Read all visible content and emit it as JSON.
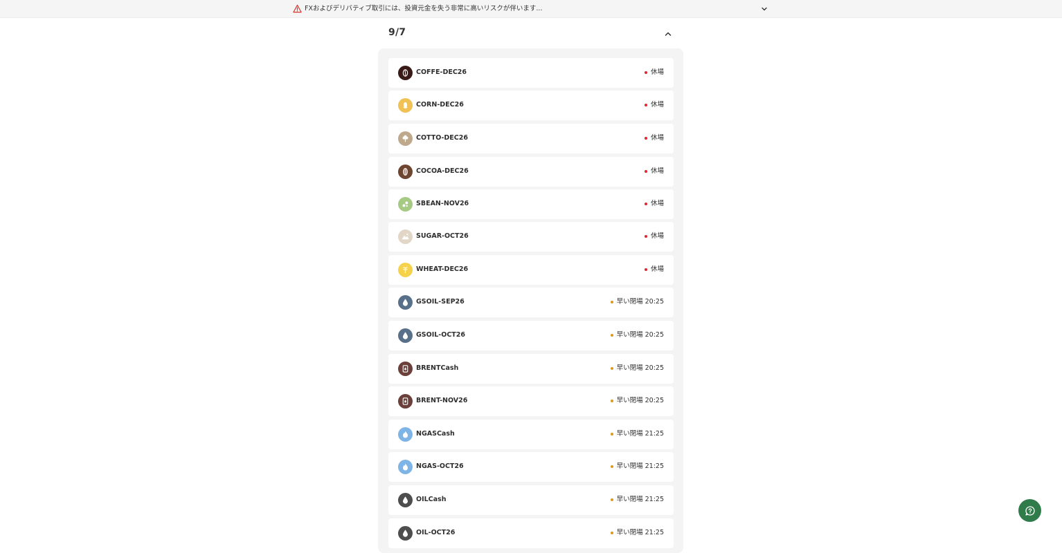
{
  "banner": {
    "text": "FXおよびデリバティブ取引には、投資元金を失う非常に高いリスクが伴います...",
    "warning_color": "#d9342b"
  },
  "section": {
    "date": "9/7"
  },
  "instruments": [
    {
      "name": "COFFE-DEC26",
      "status": "休場",
      "status_kind": "closed",
      "icon": "coffee-bean-icon",
      "icon_color": "#3a1a17"
    },
    {
      "name": "CORN-DEC26",
      "status": "休場",
      "status_kind": "closed",
      "icon": "corn-icon",
      "icon_color": "#f0c154"
    },
    {
      "name": "COTTO-DEC26",
      "status": "休場",
      "status_kind": "closed",
      "icon": "cotton-icon",
      "icon_color": "#bfa98d"
    },
    {
      "name": "COCOA-DEC26",
      "status": "休場",
      "status_kind": "closed",
      "icon": "cocoa-pod-icon",
      "icon_color": "#6e4630"
    },
    {
      "name": "SBEAN-NOV26",
      "status": "休場",
      "status_kind": "closed",
      "icon": "soybean-icon",
      "icon_color": "#a6c983"
    },
    {
      "name": "SUGAR-OCT26",
      "status": "休場",
      "status_kind": "closed",
      "icon": "sugar-icon",
      "icon_color": "#e2d6c6"
    },
    {
      "name": "WHEAT-DEC26",
      "status": "休場",
      "status_kind": "closed",
      "icon": "wheat-icon",
      "icon_color": "#f6d24a"
    },
    {
      "name": "GSOIL-SEP26",
      "status": "早い閉場 20:25",
      "status_kind": "early",
      "icon": "oil-drop-icon",
      "icon_color": "#587089"
    },
    {
      "name": "GSOIL-OCT26",
      "status": "早い閉場 20:25",
      "status_kind": "early",
      "icon": "oil-drop-icon",
      "icon_color": "#587089"
    },
    {
      "name": "BRENTCash",
      "status": "早い閉場 20:25",
      "status_kind": "early",
      "icon": "oil-barrel-icon",
      "icon_color": "#6b403a"
    },
    {
      "name": "BRENT-NOV26",
      "status": "早い閉場 20:25",
      "status_kind": "early",
      "icon": "oil-barrel-icon",
      "icon_color": "#6b403a"
    },
    {
      "name": "NGASCash",
      "status": "早い閉場 21:25",
      "status_kind": "early",
      "icon": "flame-icon",
      "icon_color": "#7fb4e6"
    },
    {
      "name": "NGAS-OCT26",
      "status": "早い閉場 21:25",
      "status_kind": "early",
      "icon": "flame-icon",
      "icon_color": "#7fb4e6"
    },
    {
      "name": "OILCash",
      "status": "早い閉場 21:25",
      "status_kind": "early",
      "icon": "oil-drop-icon",
      "icon_color": "#4e4e4e"
    },
    {
      "name": "OIL-OCT26",
      "status": "早い閉場 21:25",
      "status_kind": "early",
      "icon": "oil-drop-icon",
      "icon_color": "#4e4e4e"
    }
  ],
  "status_colors": {
    "closed": "#e0262f",
    "early": "#d99a1e"
  },
  "help": {
    "icon": "chat-help-icon",
    "color": "#2f7c4a"
  }
}
